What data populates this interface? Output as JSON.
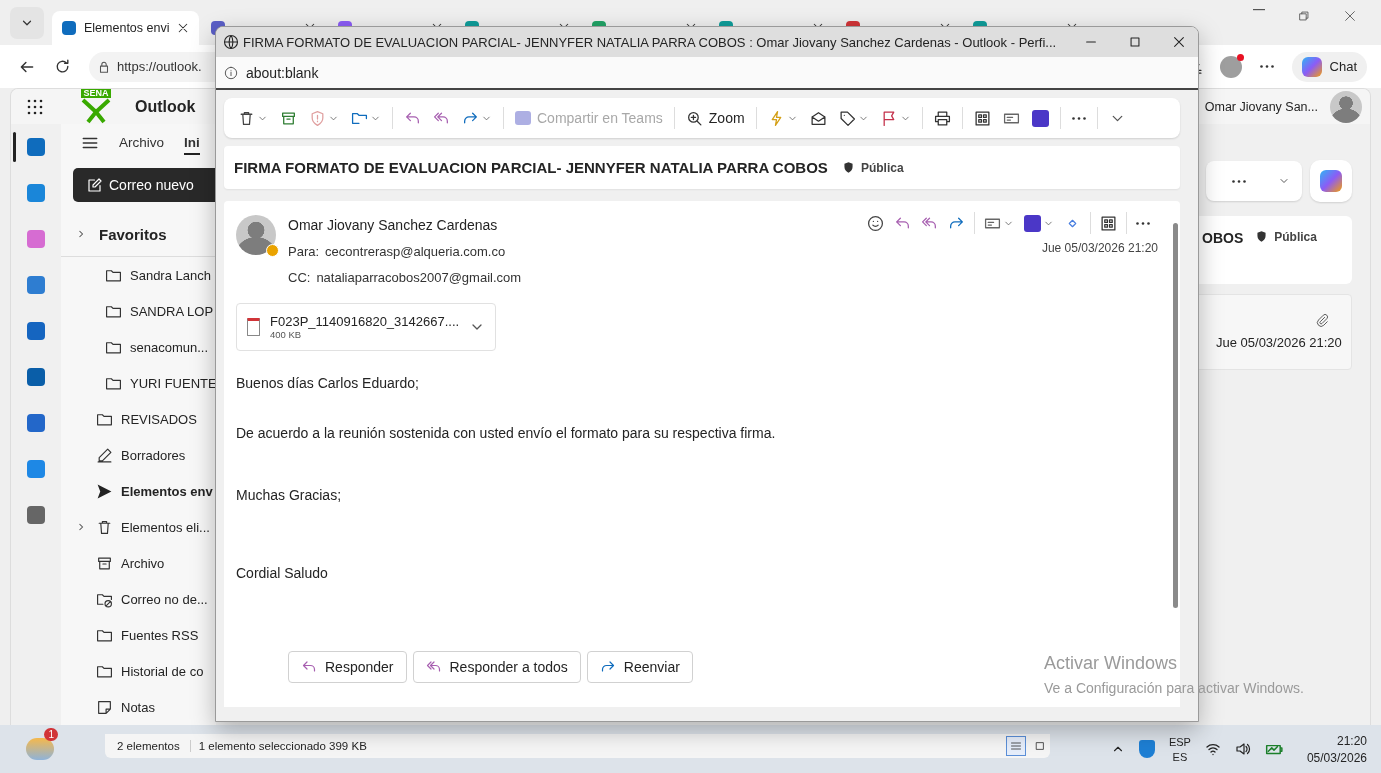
{
  "browser": {
    "tabs": [
      {
        "label": "Elementos envi",
        "selected": true,
        "color": "#0f6cbd"
      },
      {
        "selected": false,
        "color": "#5b5fc7"
      },
      {
        "selected": false,
        "color": "#8b5cf6"
      },
      {
        "selected": false,
        "color": "#0f9d9a"
      },
      {
        "selected": false,
        "color": "#21a366"
      },
      {
        "selected": false,
        "color": "#0f9d9a"
      },
      {
        "selected": false,
        "color": "#d13438"
      },
      {
        "selected": false,
        "color": "#0f9d9a"
      }
    ],
    "url": "https://outlook.",
    "chat_label": "Chat",
    "profile_alert": true
  },
  "outlook": {
    "app_name": "Outlook",
    "logo_text": "SENA",
    "user_name": "Omar Jiovany San...",
    "ribbon_tabs": [
      {
        "label": "Archivo",
        "selected": false
      },
      {
        "label": "Ini",
        "selected": true
      }
    ],
    "new_mail": "Correo nuevo",
    "favorites": {
      "label": "Favoritos",
      "expanded": false
    },
    "subfolders": [
      {
        "label": "Sandra Lanch",
        "kind": "folder"
      },
      {
        "label": "SANDRA LOP",
        "kind": "folder"
      },
      {
        "label": "senacomun...",
        "kind": "folder"
      },
      {
        "label": "YURI FUENTE",
        "kind": "folder"
      }
    ],
    "folders": [
      {
        "label": "REVISADOS",
        "kind": "folder",
        "selected": false
      },
      {
        "label": "Borradores",
        "kind": "drafts",
        "selected": false
      },
      {
        "label": "Elementos env",
        "kind": "sent",
        "selected": true
      },
      {
        "label": "Elementos eli...",
        "kind": "deleted",
        "selected": false,
        "expanded": false
      },
      {
        "label": "Archivo",
        "kind": "archive",
        "selected": false
      },
      {
        "label": "Correo no de...",
        "kind": "junk",
        "selected": false
      },
      {
        "label": "Fuentes RSS",
        "kind": "folder",
        "selected": false
      },
      {
        "label": "Historial de co",
        "kind": "folder",
        "selected": false
      },
      {
        "label": "Notas",
        "kind": "notes",
        "selected": false
      }
    ],
    "reading_pane": {
      "subject_tail": "OBOS",
      "sensitivity": "Pública"
    },
    "message_list": {
      "date": "Jue 05/03/2026 21:20",
      "has_attachment": true
    }
  },
  "popup": {
    "title": "FIRMA FORMATO DE EVALUACION PARCIAL- JENNYFER NATALIA PARRA COBOS : Omar Jiovany Sanchez Cardenas - Outlook - Perfi...",
    "url": "about:blank",
    "toolbar": {
      "teams_label": "Compartir en Teams",
      "teams_disabled": true,
      "zoom_label": "Zoom"
    },
    "subject": "FIRMA FORMATO DE EVALUACION PARCIAL- JENNYFER NATALIA PARRA COBOS",
    "sensitivity": "Pública",
    "message": {
      "sender": "Omar Jiovany Sanchez Cardenas",
      "to_label": "Para:",
      "to": "cecontrerasp@alqueria.com.co",
      "cc_label": "CC:",
      "cc": "nataliaparracobos2007@gmail.com",
      "date": "Jue 05/03/2026 21:20",
      "attachment": {
        "name": "F023P_1140916820_3142667....",
        "size": "400 KB"
      },
      "body": [
        "Buenos días Carlos Eduardo;",
        "De acuerdo a la reunión sostenida con usted envío el formato para su respectiva firma.",
        "Muchas Gracias;",
        "Cordial Saludo"
      ],
      "actions": [
        "Responder",
        "Responder a todos",
        "Reenviar"
      ]
    }
  },
  "activation": {
    "title": "Activar Windows",
    "text": "Ve a Configuración para activar Windows."
  },
  "status_bar": {
    "count": "2 elementos",
    "selection": "1 elemento seleccionado  399 KB"
  },
  "taskbar": {
    "weather_badge": "1",
    "lang": "ESP",
    "layout": "ES",
    "time": "21:20",
    "date": "05/03/2026"
  }
}
